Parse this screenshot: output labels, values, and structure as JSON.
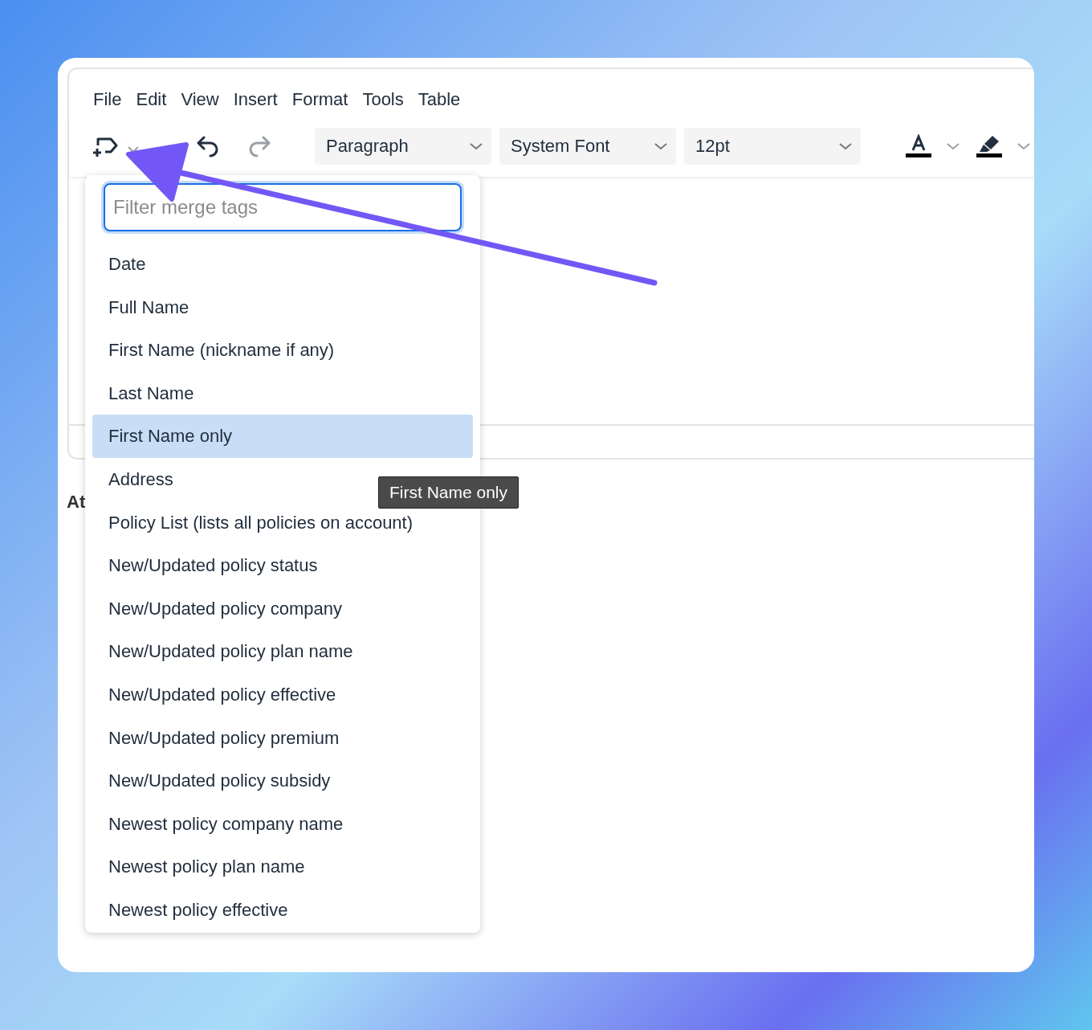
{
  "menu": [
    "File",
    "Edit",
    "View",
    "Insert",
    "Format",
    "Tools",
    "Table"
  ],
  "toolbar": {
    "undo": {
      "disabled": false
    },
    "redo": {
      "disabled": true
    },
    "selects": [
      {
        "label": "Paragraph"
      },
      {
        "label": "System Font"
      },
      {
        "label": "12pt"
      }
    ]
  },
  "below_text": "At",
  "merge_tags": {
    "placeholder": "Filter merge tags",
    "items": [
      {
        "label": "Date",
        "selected": false
      },
      {
        "label": "Full Name",
        "selected": false
      },
      {
        "label": "First Name (nickname if any)",
        "selected": false
      },
      {
        "label": "Last Name",
        "selected": false
      },
      {
        "label": "First Name only",
        "selected": true
      },
      {
        "label": "Address",
        "selected": false
      },
      {
        "label": "Policy List (lists all policies on account)",
        "selected": false
      },
      {
        "label": "New/Updated policy status",
        "selected": false
      },
      {
        "label": "New/Updated policy company",
        "selected": false
      },
      {
        "label": "New/Updated policy plan name",
        "selected": false
      },
      {
        "label": "New/Updated policy effective",
        "selected": false
      },
      {
        "label": "New/Updated policy premium",
        "selected": false
      },
      {
        "label": "New/Updated policy subsidy",
        "selected": false
      },
      {
        "label": "Newest policy company name",
        "selected": false
      },
      {
        "label": "Newest policy plan name",
        "selected": false
      },
      {
        "label": "Newest policy effective",
        "selected": false
      }
    ]
  },
  "tooltip": "First Name only"
}
